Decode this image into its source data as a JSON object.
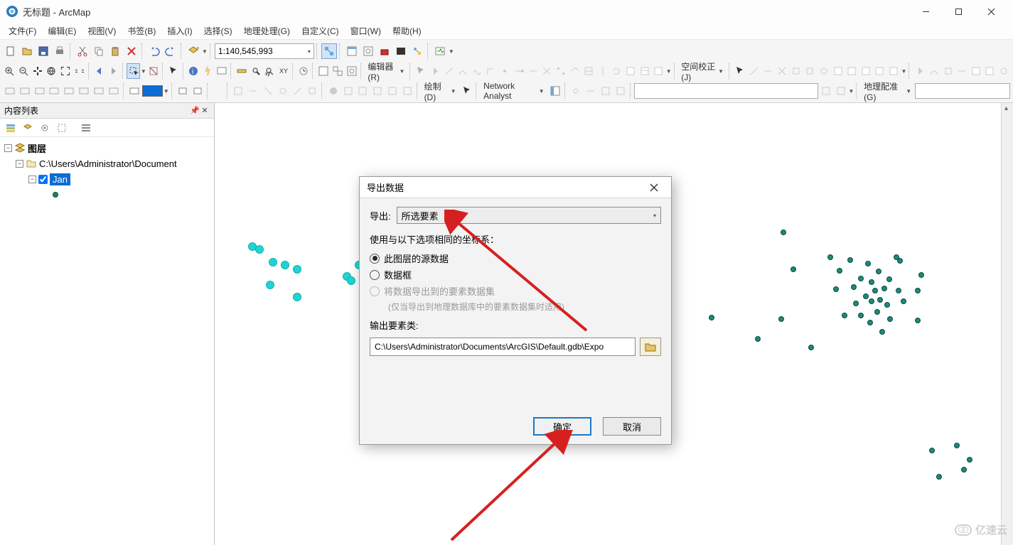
{
  "window": {
    "title": "无标题 - ArcMap",
    "minimize": "−",
    "maximize": "☐",
    "close": "×"
  },
  "menubar": [
    "文件(F)",
    "编辑(E)",
    "视图(V)",
    "书签(B)",
    "插入(I)",
    "选择(S)",
    "地理处理(G)",
    "自定义(C)",
    "窗口(W)",
    "帮助(H)"
  ],
  "toolbar": {
    "scale": "1:140,545,993",
    "editor_label": "编辑器(R)",
    "spatial_adjust_label": "空间校正(J)",
    "draw_label": "绘制(D)",
    "network_analyst_label": "Network Analyst",
    "georef_label": "地理配准(G)"
  },
  "toc": {
    "header": "内容列表",
    "root": "图层",
    "datasource": "C:\\Users\\Administrator\\Document",
    "layer": "Jan"
  },
  "dialog": {
    "title": "导出数据",
    "export_label": "导出:",
    "export_value": "所选要素",
    "coord_label": "使用与以下选项相同的坐标系：",
    "radio_source": "此图层的源数据",
    "radio_dataframe": "数据框",
    "radio_fc": "将数据导出到的要素数据集",
    "radio_fc_sub": "(仅当导出到地理数据库中的要素数据集时适用)",
    "output_label": "输出要素类:",
    "output_value": "C:\\Users\\Administrator\\Documents\\ArcGIS\\Default.gdb\\Expo",
    "ok": "确定",
    "cancel": "取消"
  },
  "watermark": "亿速云"
}
